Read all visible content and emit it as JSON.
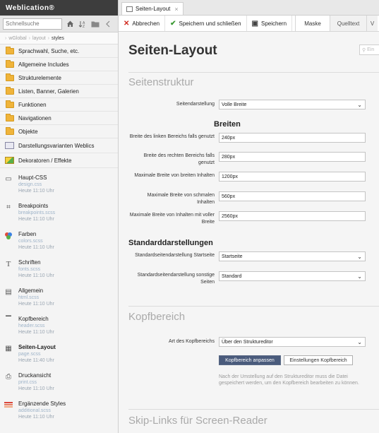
{
  "app": {
    "brand": "Weblication®"
  },
  "sidebar": {
    "search_placeholder": "Schnellsuche",
    "breadcrumb": [
      "wGlobal",
      "layout",
      "styles"
    ],
    "folders": [
      "Sprachwahl, Suche, etc.",
      "Allgemeine Includes",
      "Strukturelemente",
      "Listen, Banner, Galerien",
      "Funktionen",
      "Navigationen",
      "Objekte"
    ],
    "groups": [
      "Darstellungsvarianten Weblics",
      "Dekoratoren / Effekte"
    ],
    "files": [
      {
        "title": "Haupt-CSS",
        "name": "design.css",
        "date": "Heute 11:10 Uhr",
        "icon": "css-file-icon"
      },
      {
        "title": "Breakpoints",
        "name": "breakpoints.scss",
        "date": "Heute 11:10 Uhr",
        "icon": "breakpoints-icon"
      },
      {
        "title": "Farben",
        "name": "colors.scss",
        "date": "Heute 11:10 Uhr",
        "icon": "colors-icon"
      },
      {
        "title": "Schriften",
        "name": "fonts.scss",
        "date": "Heute 11:10 Uhr",
        "icon": "fonts-icon"
      },
      {
        "title": "Allgemein",
        "name": "html.scss",
        "date": "Heute 11:10 Uhr",
        "icon": "html-icon"
      },
      {
        "title": "Kopfbereich",
        "name": "header.scss",
        "date": "Heute 11:10 Uhr",
        "icon": "header-icon"
      },
      {
        "title": "Seiten-Layout",
        "name": "page.scss",
        "date": "Heute 11:40 Uhr",
        "icon": "page-layout-icon"
      },
      {
        "title": "Druckansicht",
        "name": "print.css",
        "date": "Heute 11:10 Uhr",
        "icon": "print-icon"
      },
      {
        "title": "Ergänzende Styles",
        "name": "additional.scss",
        "date": "Heute 11:10 Uhr",
        "icon": "additional-styles-icon"
      }
    ]
  },
  "tab": {
    "label": "Seiten-Layout"
  },
  "toolbar": {
    "cancel": "Abbrechen",
    "save_close": "Speichern und schließen",
    "save": "Speichern",
    "view_tabs": [
      "Maske",
      "Quelltext",
      "V"
    ]
  },
  "page": {
    "title": "Seiten-Layout",
    "search_placeholder": "Ein",
    "seitenstruktur": {
      "title": "Seitenstruktur",
      "seitendarstellung_label": "Seitendarstellung",
      "seitendarstellung_value": "Volle Breite",
      "breiten_title": "Breiten",
      "fields": [
        {
          "label": "Breite des linken Bereichs falls genutzt",
          "value": "240px"
        },
        {
          "label": "Breite des rechten Bereichs falls genutzt",
          "value": "280px"
        },
        {
          "label": "Maximale Breite von breiten Inhalten",
          "value": "1200px"
        },
        {
          "label": "Maximale Breite von schmalen Inhalten",
          "value": "560px"
        },
        {
          "label": "Maximale Breite von Inhalten mit voller Breite",
          "value": "2560px"
        }
      ],
      "standard_title": "Standarddarstellungen",
      "std_start_label": "Standardseitendarstellung Startseite",
      "std_start_value": "Startseite",
      "std_other_label": "Standardseitendarstellung sonstige Seiten",
      "std_other_value": "Standard"
    },
    "kopfbereich": {
      "title": "Kopfbereich",
      "art_label": "Art des Kopfbereichs",
      "art_value": "Über den Struktureditor",
      "btn_customize": "Kopfbereich anpassen",
      "btn_settings": "Einstellungen Kopfbereich",
      "note": "Nach der Umstellung auf den Struktureditor muss die Datei gespeichert werden, um den Kopfbereich bearbeiten zu können."
    },
    "skiplinks": {
      "title": "Skip-Links für Screen-Reader"
    }
  }
}
